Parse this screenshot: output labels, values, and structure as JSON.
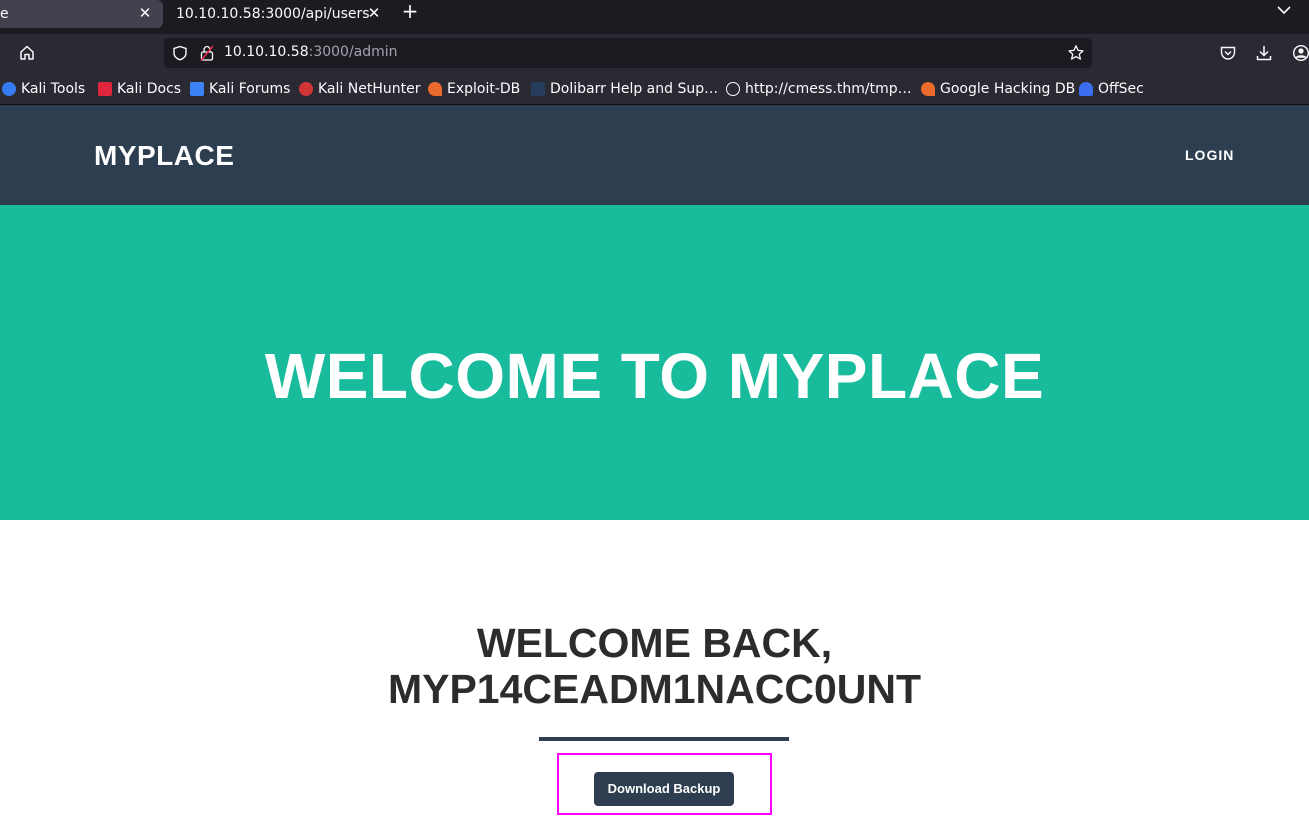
{
  "browser": {
    "tabs": [
      {
        "label": "e",
        "active": false
      },
      {
        "label": "10.10.10.58:3000/api/users",
        "active": true
      }
    ],
    "url": {
      "host": "10.10.10.58",
      "rest": ":3000/admin"
    },
    "bookmarks": [
      {
        "label": "Kali Tools",
        "icon": "kali-tools-icon",
        "color": "#367bf0"
      },
      {
        "label": "Kali Docs",
        "icon": "kali-docs-icon",
        "color": "#e0263a"
      },
      {
        "label": "Kali Forums",
        "icon": "kali-forums-icon",
        "color": "#3b82f6"
      },
      {
        "label": "Kali NetHunter",
        "icon": "kali-nethunter-icon",
        "color": "#d23535"
      },
      {
        "label": "Exploit-DB",
        "icon": "exploit-db-icon",
        "color": "#ea6b2d"
      },
      {
        "label": "Dolibarr Help and Sup…",
        "icon": "dolibarr-icon",
        "color": "#263c5c"
      },
      {
        "label": "http://cmess.thm/tmp…",
        "icon": "globe-icon",
        "color": "#fbfbfe"
      },
      {
        "label": "Google Hacking DB",
        "icon": "ghdb-icon",
        "color": "#ea6b2d"
      },
      {
        "label": "OffSec",
        "icon": "offsec-icon",
        "color": "#3b6df0"
      }
    ]
  },
  "site": {
    "brand": "MYPLACE",
    "nav_login": "LOGIN",
    "hero_title": "WELCOME TO MYPLACE",
    "welcome_line1": "WELCOME BACK,",
    "welcome_line2": "MYP14CEADM1NACC0UNT",
    "download_label": "Download Backup"
  },
  "colors": {
    "header": "#2c3e50",
    "hero": "#18bc9c",
    "highlight": "#ff00ff"
  }
}
